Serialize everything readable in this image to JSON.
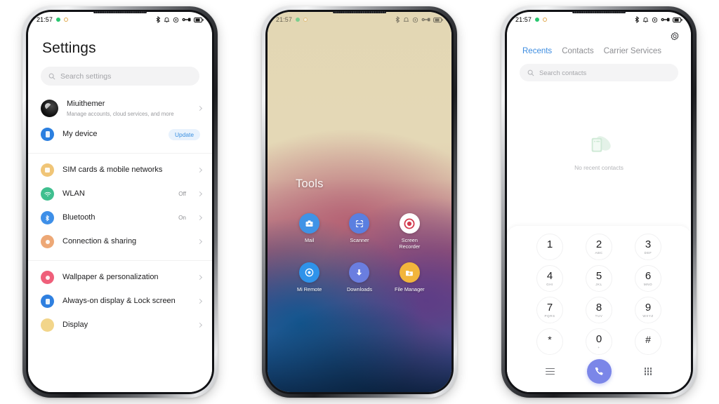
{
  "status_bar": {
    "time": "21:57",
    "icons": [
      "bluetooth-icon",
      "alarm-icon",
      "dnd-icon",
      "vpn-key-icon",
      "battery-icon"
    ]
  },
  "phone_settings": {
    "title": "Settings",
    "search": {
      "placeholder": "Search settings",
      "icon": "search-icon"
    },
    "groups": [
      {
        "rows": [
          {
            "label": "Miuithemer",
            "sub": "Manage accounts, cloud services, and more",
            "icon": "account-avatar",
            "color": "#111111",
            "value": "",
            "badge": "",
            "chevron": true
          },
          {
            "label": "My device",
            "sub": "",
            "icon": "phone-icon",
            "color": "#2b7fe0",
            "value": "",
            "badge": "Update",
            "chevron": false
          }
        ]
      },
      {
        "rows": [
          {
            "label": "SIM cards & mobile networks",
            "sub": "",
            "icon": "sim-card-icon",
            "color": "#f0c577",
            "value": "",
            "badge": "",
            "chevron": true
          },
          {
            "label": "WLAN",
            "sub": "",
            "icon": "wifi-icon",
            "color": "#3fbf8f",
            "value": "Off",
            "badge": "",
            "chevron": true
          },
          {
            "label": "Bluetooth",
            "sub": "",
            "icon": "bluetooth-icon",
            "color": "#3e8fe8",
            "value": "On",
            "badge": "",
            "chevron": true
          },
          {
            "label": "Connection & sharing",
            "sub": "",
            "icon": "connection-sharing-icon",
            "color": "#eda876",
            "value": "",
            "badge": "",
            "chevron": true
          }
        ]
      },
      {
        "rows": [
          {
            "label": "Wallpaper & personalization",
            "sub": "",
            "icon": "wallpaper-icon",
            "color": "#ef5f7a",
            "value": "",
            "badge": "",
            "chevron": true
          },
          {
            "label": "Always-on display & Lock screen",
            "sub": "",
            "icon": "lock-screen-icon",
            "color": "#2f80e0",
            "value": "",
            "badge": "",
            "chevron": true
          },
          {
            "label": "Display",
            "sub": "",
            "icon": "display-icon",
            "color": "#f2d58a",
            "value": "",
            "badge": "",
            "chevron": true
          }
        ]
      }
    ]
  },
  "phone_home": {
    "folder_title": "Tools",
    "apps": [
      {
        "name": "Mail",
        "icon": "mail-icon",
        "color": "#3f93e6"
      },
      {
        "name": "Scanner",
        "icon": "scanner-icon",
        "color": "#5a7fe0"
      },
      {
        "name": "Screen Recorder",
        "icon": "screen-recorder-icon",
        "color": "#ffffff"
      },
      {
        "name": "Mi Remote",
        "icon": "mi-remote-icon",
        "color": "#2f93ea"
      },
      {
        "name": "Downloads",
        "icon": "download-icon",
        "color": "#6a7ee0"
      },
      {
        "name": "File Manager",
        "icon": "file-manager-icon",
        "color": "#f2b53c"
      }
    ]
  },
  "phone_dialer": {
    "gear_icon": "gear-icon",
    "tabs": [
      {
        "label": "Recents",
        "active": true
      },
      {
        "label": "Contacts",
        "active": false
      },
      {
        "label": "Carrier Services",
        "active": false
      }
    ],
    "search": {
      "placeholder": "Search contacts",
      "icon": "search-icon"
    },
    "empty_state": {
      "icon": "no-contacts-illustration",
      "caption": "No recent contacts"
    },
    "keys": [
      {
        "digit": "1",
        "letters": ""
      },
      {
        "digit": "2",
        "letters": "ABC"
      },
      {
        "digit": "3",
        "letters": "DEF"
      },
      {
        "digit": "4",
        "letters": "GHI"
      },
      {
        "digit": "5",
        "letters": "JKL"
      },
      {
        "digit": "6",
        "letters": "MNO"
      },
      {
        "digit": "7",
        "letters": "PQRS"
      },
      {
        "digit": "8",
        "letters": "TUV"
      },
      {
        "digit": "9",
        "letters": "WXYZ"
      },
      {
        "digit": "*",
        "letters": ""
      },
      {
        "digit": "0",
        "letters": "+"
      },
      {
        "digit": "#",
        "letters": ""
      }
    ],
    "actions": {
      "menu_icon": "hamburger-menu-icon",
      "call_icon": "call-icon",
      "keypad_icon": "keypad-grid-icon"
    },
    "accent": "#7b86e8",
    "tab_accent": "#3c8ce0"
  }
}
